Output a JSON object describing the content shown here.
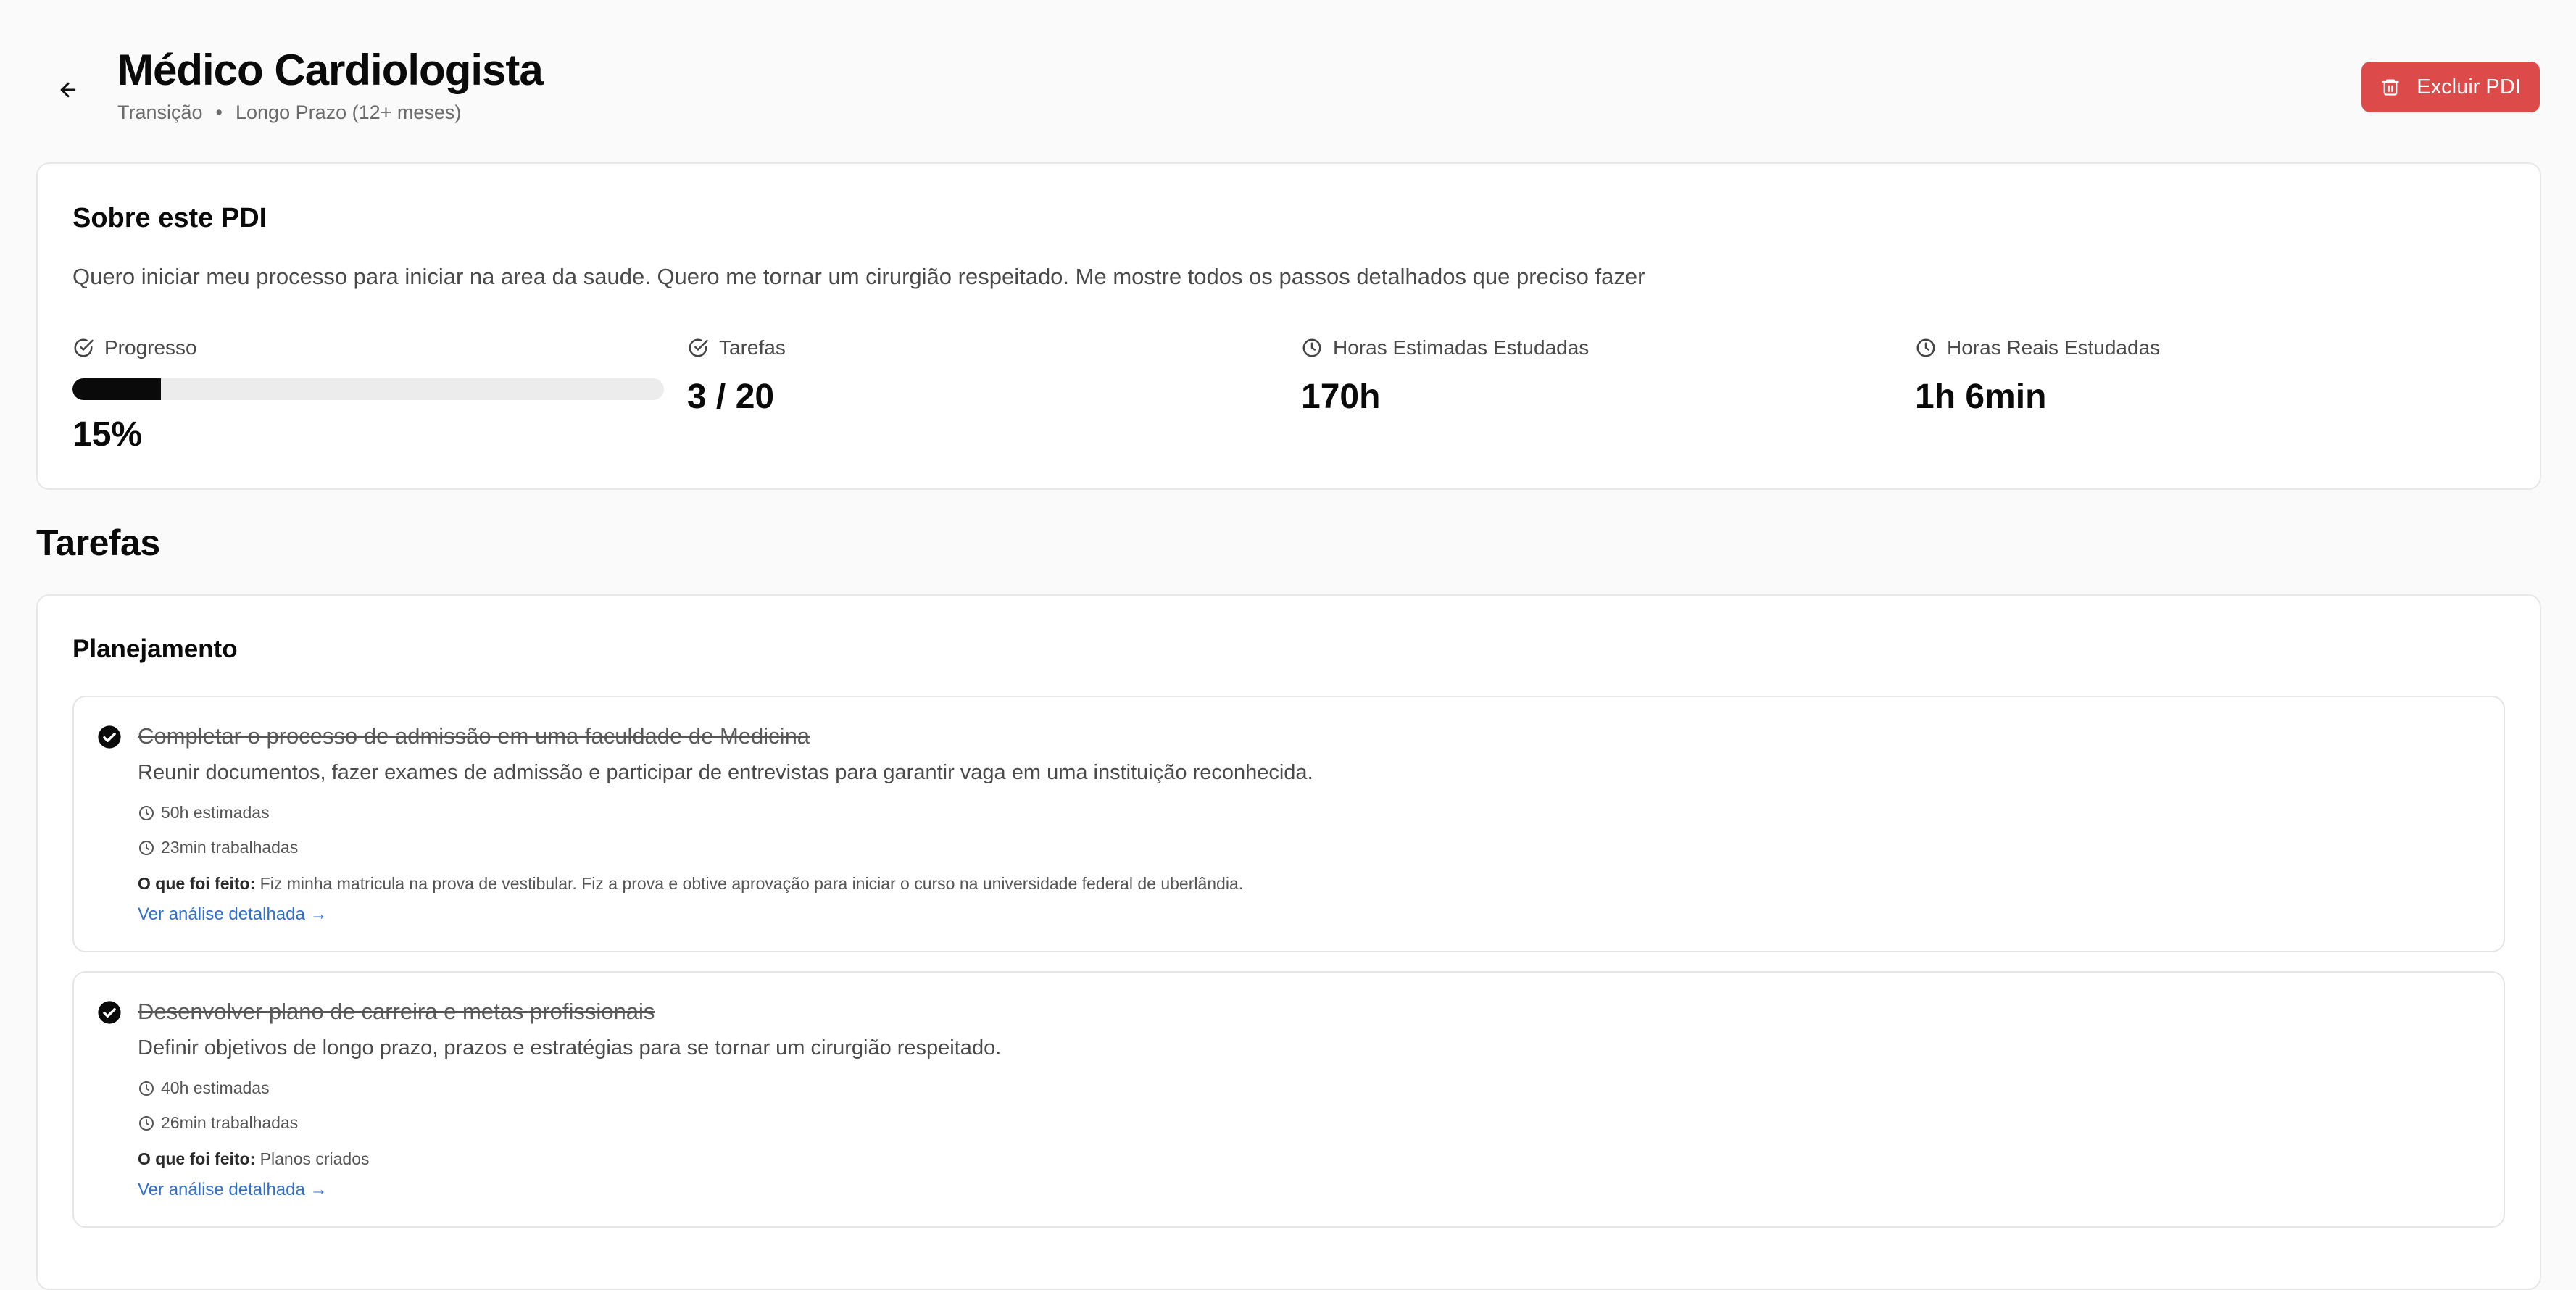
{
  "header": {
    "title": "Médico Cardiologista",
    "type": "Transição",
    "separator": "•",
    "term": "Longo Prazo (12+ meses)",
    "delete_label": "Excluir PDI"
  },
  "about": {
    "title": "Sobre este PDI",
    "description": "Quero iniciar meu processo para iniciar na area da saude. Quero me tornar um cirurgião respeitado. Me mostre todos os passos detalhados que preciso fazer",
    "stats": {
      "progress": {
        "label": "Progresso",
        "value": "15%",
        "fraction": 0.15
      },
      "tasks": {
        "label": "Tarefas",
        "value": "3 / 20"
      },
      "estimated": {
        "label": "Horas Estimadas Estudadas",
        "value": "170h"
      },
      "actual": {
        "label": "Horas Reais Estudadas",
        "value": "1h 6min"
      }
    }
  },
  "tasks_section": {
    "title": "Tarefas",
    "group_title": "Planejamento",
    "done_prefix": "O que foi feito:",
    "items": [
      {
        "title": "Completar o processo de admissão em uma faculdade de Medicina",
        "description": "Reunir documentos, fazer exames de admissão e participar de entrevistas para garantir vaga em uma instituição reconhecida.",
        "estimated": "50h estimadas",
        "worked": "23min trabalhadas",
        "done_text": "Fiz minha matricula na prova de vestibular. Fiz a prova e obtive aprovação para iniciar o curso na universidade federal de uberlândia.",
        "link": "Ver análise detalhada →"
      },
      {
        "title": "Desenvolver plano de carreira e metas profissionais",
        "description": "Definir objetivos de longo prazo, prazos e estratégias para se tornar um cirurgião respeitado.",
        "estimated": "40h estimadas",
        "worked": "26min trabalhadas",
        "done_text": "Planos criados",
        "link": "Ver análise detalhada →"
      }
    ]
  },
  "colors": {
    "danger": "#dc4a4a",
    "link": "#2f6fd1",
    "progress_fill": "#0a0a0a"
  },
  "icons": [
    "arrow-left-icon",
    "trash-icon",
    "check-circle-icon",
    "clock-icon",
    "checked-filled-icon"
  ]
}
